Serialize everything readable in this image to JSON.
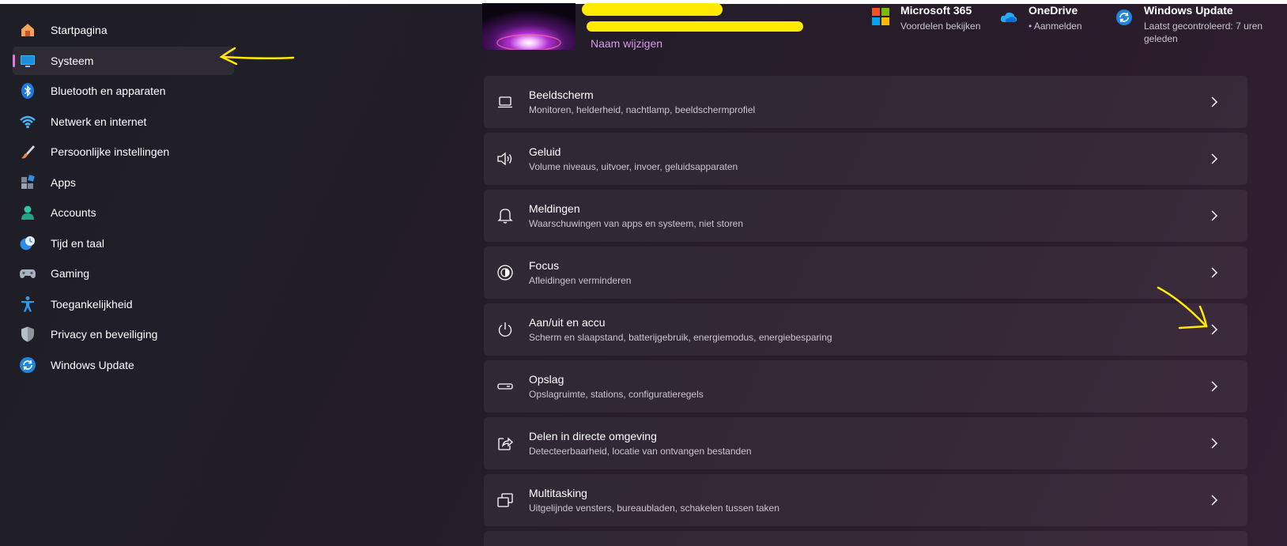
{
  "sidebar": {
    "items": [
      {
        "label": "Startpagina",
        "icon": "home-icon"
      },
      {
        "label": "Systeem",
        "icon": "monitor-icon",
        "selected": true
      },
      {
        "label": "Bluetooth en apparaten",
        "icon": "bluetooth-icon"
      },
      {
        "label": "Netwerk en internet",
        "icon": "wifi-icon"
      },
      {
        "label": "Persoonlijke instellingen",
        "icon": "brush-icon"
      },
      {
        "label": "Apps",
        "icon": "apps-icon"
      },
      {
        "label": "Accounts",
        "icon": "person-icon"
      },
      {
        "label": "Tijd en taal",
        "icon": "clock-globe-icon"
      },
      {
        "label": "Gaming",
        "icon": "gamepad-icon"
      },
      {
        "label": "Toegankelijkheid",
        "icon": "accessibility-icon"
      },
      {
        "label": "Privacy en beveiliging",
        "icon": "shield-icon"
      },
      {
        "label": "Windows Update",
        "icon": "sync-icon"
      }
    ]
  },
  "profile": {
    "rename_label": "Naam wijzigen"
  },
  "tiles": {
    "m365": {
      "title": "Microsoft 365",
      "subtitle": "Voordelen bekijken",
      "icon": "microsoft-logo-icon"
    },
    "onedrive": {
      "title": "OneDrive",
      "subtitle": "Aanmelden",
      "icon": "cloud-icon"
    },
    "update": {
      "title": "Windows Update",
      "subtitle": "Laatst gecontroleerd: 7 uren geleden",
      "icon": "sync-icon"
    }
  },
  "cards": [
    {
      "title": "Beeldscherm",
      "subtitle": "Monitoren, helderheid, nachtlamp, beeldschermprofiel",
      "icon": "laptop-icon"
    },
    {
      "title": "Geluid",
      "subtitle": "Volume niveaus, uitvoer, invoer, geluidsapparaten",
      "icon": "speaker-icon"
    },
    {
      "title": "Meldingen",
      "subtitle": "Waarschuwingen van apps en systeem, niet storen",
      "icon": "bell-icon"
    },
    {
      "title": "Focus",
      "subtitle": "Afleidingen verminderen",
      "icon": "focus-icon"
    },
    {
      "title": "Aan/uit en accu",
      "subtitle": "Scherm en slaapstand, batterijgebruik, energiemodus, energiebesparing",
      "icon": "power-icon"
    },
    {
      "title": "Opslag",
      "subtitle": "Opslagruimte, stations, configuratieregels",
      "icon": "storage-icon"
    },
    {
      "title": "Delen in directe omgeving",
      "subtitle": "Detecteerbaarheid, locatie van ontvangen bestanden",
      "icon": "share-icon"
    },
    {
      "title": "Multitasking",
      "subtitle": "Uitgelijnde vensters, bureaubladen, schakelen tussen taken",
      "icon": "multitask-icon"
    }
  ],
  "colors": {
    "accent": "#e17ad6",
    "link": "#d79ae8",
    "annotation": "#ffea00"
  }
}
